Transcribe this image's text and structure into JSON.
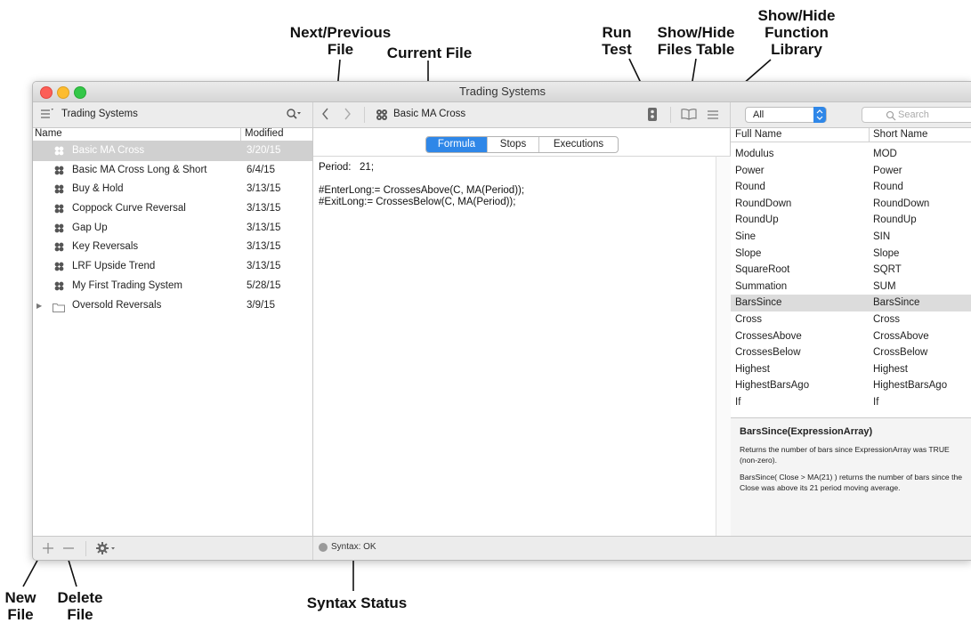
{
  "annotations": {
    "next_prev": "Next/Previous\nFile",
    "current_file": "Current File",
    "run_test": "Run\nTest",
    "show_hide_files": "Show/Hide\nFiles Table",
    "show_hide_library": "Show/Hide\nFunction\nLibrary",
    "new_file": "New\nFile",
    "delete_file": "Delete\nFile",
    "syntax_status": "Syntax Status"
  },
  "window": {
    "title": "Trading Systems"
  },
  "toolbar": {
    "files_title": "Trading Systems",
    "current_file": "Basic MA Cross",
    "filter_value": "All",
    "search_placeholder": "Search"
  },
  "files": {
    "headers": {
      "name": "Name",
      "modified": "Modified"
    },
    "items": [
      {
        "name": "Basic MA Cross",
        "modified": "3/20/15",
        "selected": true,
        "type": "system"
      },
      {
        "name": "Basic MA Cross Long & Short",
        "modified": "6/4/15",
        "type": "system"
      },
      {
        "name": "Buy & Hold",
        "modified": "3/13/15",
        "type": "system"
      },
      {
        "name": "Coppock Curve Reversal",
        "modified": "3/13/15",
        "type": "system"
      },
      {
        "name": "Gap Up",
        "modified": "3/13/15",
        "type": "system"
      },
      {
        "name": "Key Reversals",
        "modified": "3/13/15",
        "type": "system"
      },
      {
        "name": "LRF Upside Trend",
        "modified": "3/13/15",
        "type": "system"
      },
      {
        "name": "My First Trading System",
        "modified": "5/28/15",
        "type": "system"
      },
      {
        "name": "Oversold Reversals",
        "modified": "3/9/15",
        "type": "folder"
      }
    ]
  },
  "editor": {
    "tabs": [
      "Formula",
      "Stops",
      "Executions"
    ],
    "active_tab": "Formula",
    "lines": [
      "Period:   21;",
      "",
      "#EnterLong:= CrossesAbove(C, MA(Period));",
      "#ExitLong:= CrossesBelow(C, MA(Period));"
    ]
  },
  "library": {
    "headers": {
      "full": "Full Name",
      "short": "Short Name"
    },
    "items": [
      {
        "full": "Modulus",
        "short": "MOD"
      },
      {
        "full": "Power",
        "short": "Power"
      },
      {
        "full": "Round",
        "short": "Round"
      },
      {
        "full": "RoundDown",
        "short": "RoundDown"
      },
      {
        "full": "RoundUp",
        "short": "RoundUp"
      },
      {
        "full": "Sine",
        "short": "SIN"
      },
      {
        "full": "Slope",
        "short": "Slope"
      },
      {
        "full": "SquareRoot",
        "short": "SQRT"
      },
      {
        "full": "Summation",
        "short": "SUM"
      },
      {
        "full": "BarsSince",
        "short": "BarsSince",
        "selected": true
      },
      {
        "full": "Cross",
        "short": "Cross"
      },
      {
        "full": "CrossesAbove",
        "short": "CrossAbove"
      },
      {
        "full": "CrossesBelow",
        "short": "CrossBelow"
      },
      {
        "full": "Highest",
        "short": "Highest"
      },
      {
        "full": "HighestBarsAgo",
        "short": "HighestBarsAgo"
      },
      {
        "full": "If",
        "short": "If"
      }
    ],
    "detail": {
      "signature": "BarsSince(ExpressionArray)",
      "description": "Returns the number of bars since ExpressionArray was TRUE (non-zero).",
      "example": "BarsSince( Close > MA(21) ) returns the number of bars since the Close was above its 21 period moving average."
    }
  },
  "status": {
    "syntax": "Syntax: OK"
  },
  "colors": {
    "accent": "#2f87e8",
    "selection": "#d0d0d0",
    "close": "#fc5f57",
    "minimize": "#fdbc2e",
    "zoom": "#33c748"
  }
}
